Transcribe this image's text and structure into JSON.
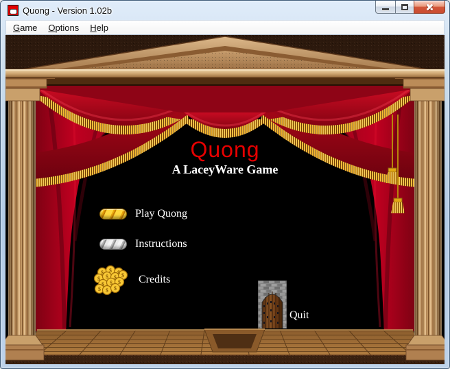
{
  "window": {
    "title": "Quong - Version 1.02b",
    "app_icon": "quong-red-pill-icon",
    "controls": [
      {
        "name": "minimize"
      },
      {
        "name": "maximize"
      },
      {
        "name": "close"
      }
    ]
  },
  "menu_bar": {
    "items": [
      {
        "label": "Game",
        "hotkey": "G"
      },
      {
        "label": "Options",
        "hotkey": "O"
      },
      {
        "label": "Help",
        "hotkey": "H"
      }
    ]
  },
  "stage": {
    "title": "Quong",
    "subtitle": "A LaceyWare Game",
    "menu_items": [
      {
        "label": "Play Quong",
        "icon": "gold-bar-icon"
      },
      {
        "label": "Instructions",
        "icon": "silver-bar-icon"
      },
      {
        "label": "Credits",
        "icon": "coin-pile-icon"
      }
    ],
    "quit": {
      "label": "Quit",
      "icon": "door-icon"
    },
    "coin_symbol": "$"
  },
  "colors": {
    "title_red": "#e60000",
    "curtain_red": "#b50018",
    "fringe_gold": "#f2b62e",
    "wood_light": "#cfa673",
    "wood_dark": "#5f3a1d",
    "stage_background": "#000000"
  }
}
